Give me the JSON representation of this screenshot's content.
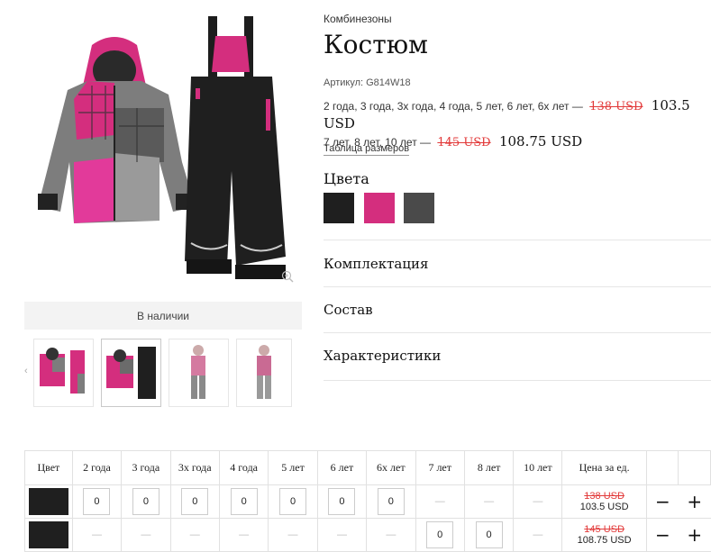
{
  "product": {
    "category": "Комбинезоны",
    "title": "Костюм",
    "sku_label": "Артикул: G814W18",
    "stock": "В наличии",
    "size_table_link": "Таблица размеров",
    "colors_heading": "Цвета",
    "colors": [
      "#1f1f1f",
      "#d42e7e",
      "#4a4a4a"
    ],
    "price_rows": [
      {
        "sizes": "2 года, 3 года, 3х года, 4 года, 5 лет, 6 лет, 6х лет —",
        "old": "138 USD",
        "new": "103.5 USD"
      },
      {
        "sizes": "7 лет, 8 лет, 10 лет —",
        "old": "145 USD",
        "new": "108.75 USD"
      }
    ],
    "accordion": [
      "Комплектация",
      "Состав",
      "Характеристики"
    ]
  },
  "table": {
    "headers": [
      "Цвет",
      "2 года",
      "3 года",
      "3х года",
      "4 года",
      "5 лет",
      "6 лет",
      "6х лет",
      "7 лет",
      "8 лет",
      "10 лет",
      "Цена за ед."
    ],
    "rows": [
      {
        "color": "#1f1f1f",
        "cells": [
          "0",
          "0",
          "0",
          "0",
          "0",
          "0",
          "0",
          "—",
          "—",
          "—"
        ],
        "old": "138 USD",
        "new": "103.5 USD",
        "minus": "−",
        "plus": "+"
      },
      {
        "color": "#1f1f1f",
        "cells": [
          "—",
          "—",
          "—",
          "—",
          "—",
          "—",
          "—",
          "0",
          "0",
          "—"
        ],
        "old": "145 USD",
        "new": "108.75 USD",
        "minus": "−",
        "plus": "+"
      }
    ]
  },
  "icons": {
    "zoom": "zoom-icon",
    "prev": "chevron-left-icon",
    "next": "chevron-right-icon"
  }
}
